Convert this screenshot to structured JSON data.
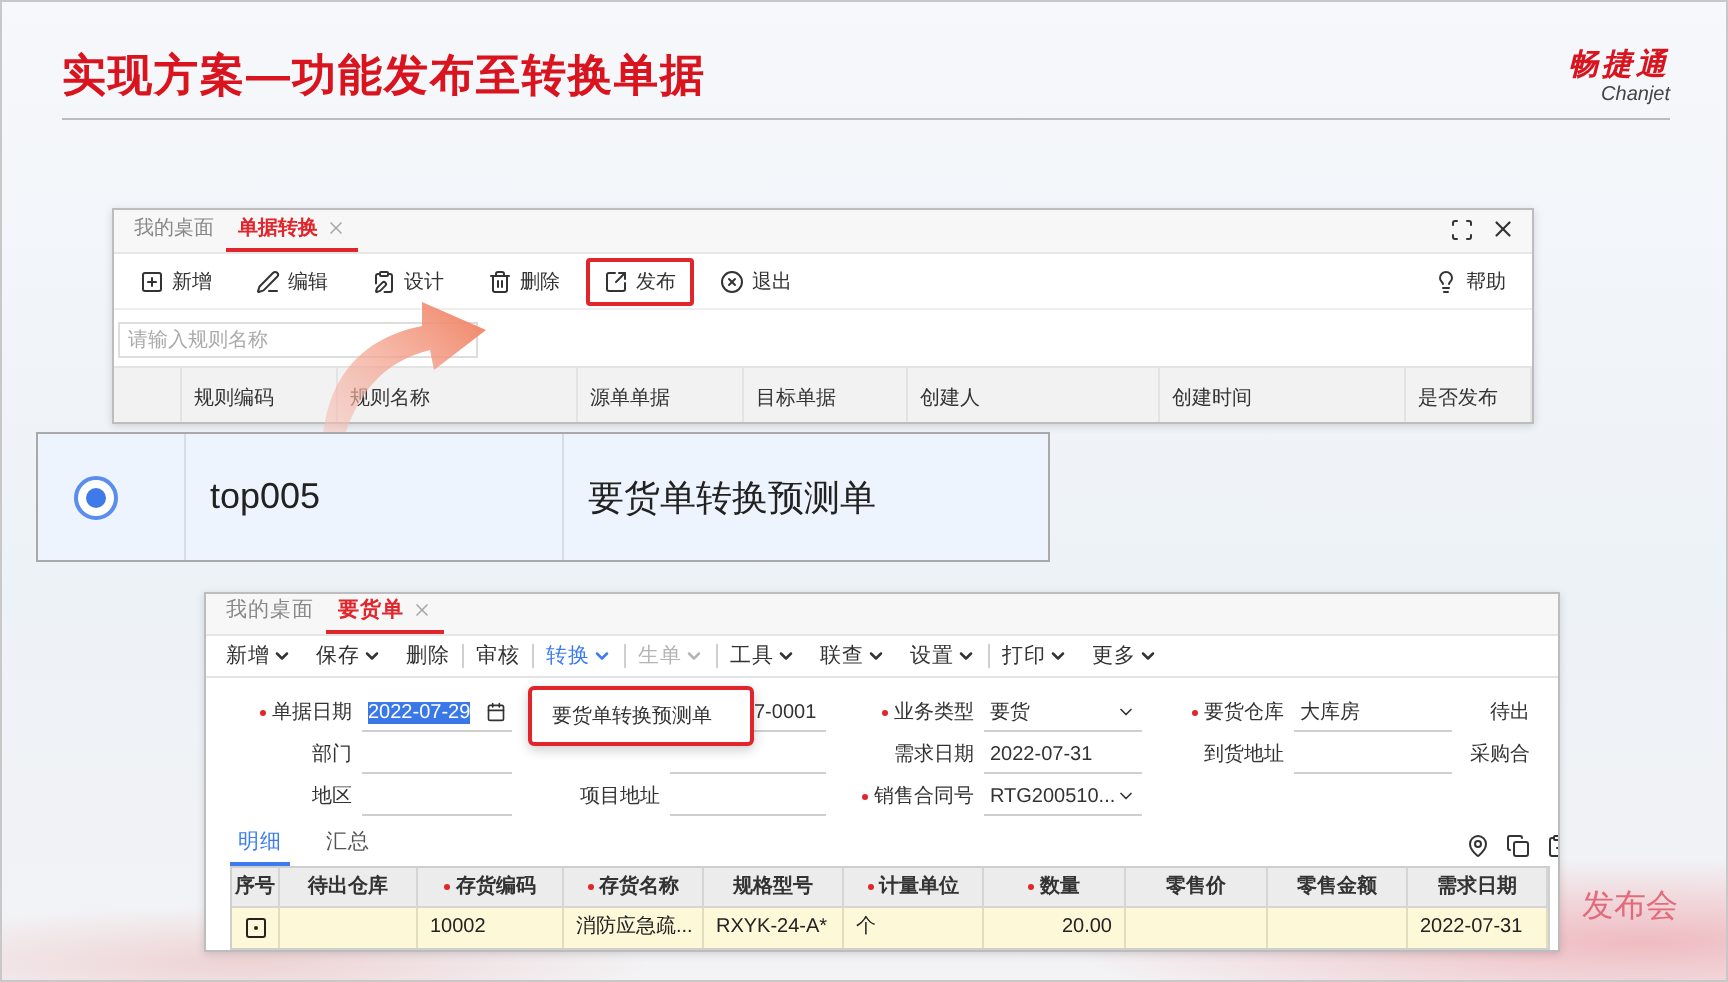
{
  "title": "实现方案—功能发布至转换单据",
  "logo": {
    "name": "畅捷通",
    "latin": "Chanjet"
  },
  "rule_window": {
    "tabs": [
      {
        "label": "我的桌面",
        "selected": false,
        "closable": false
      },
      {
        "label": "单据转换",
        "selected": true,
        "closable": true
      }
    ],
    "toolbar": [
      {
        "label": "新增",
        "highlighted": false
      },
      {
        "label": "编辑",
        "highlighted": false
      },
      {
        "label": "设计",
        "highlighted": false
      },
      {
        "label": "删除",
        "highlighted": false
      },
      {
        "label": "发布",
        "highlighted": true
      },
      {
        "label": "退出",
        "highlighted": false
      }
    ],
    "help": "帮助",
    "search": {
      "placeholder": "请输入规则名称"
    },
    "columns": [
      "规则编码",
      "规则名称",
      "源单单据",
      "目标单据",
      "创建人",
      "创建时间",
      "是否发布"
    ]
  },
  "zoomed_row": {
    "selected": true,
    "code": "top005",
    "name": "要货单转换预测单"
  },
  "order_window": {
    "tabs": [
      {
        "label": "我的桌面",
        "selected": false,
        "closable": false
      },
      {
        "label": "要货单",
        "selected": true,
        "closable": true
      }
    ],
    "toolbar": [
      {
        "label": "新增",
        "dropdown": true,
        "active": false,
        "disabled": false,
        "separator_after": false
      },
      {
        "label": "保存",
        "dropdown": true,
        "active": false,
        "disabled": false,
        "separator_after": false
      },
      {
        "label": "删除",
        "dropdown": false,
        "active": false,
        "disabled": false,
        "separator_after": true
      },
      {
        "label": "审核",
        "dropdown": false,
        "active": false,
        "disabled": false,
        "separator_after": true
      },
      {
        "label": "转换",
        "dropdown": true,
        "active": true,
        "disabled": false,
        "separator_after": true
      },
      {
        "label": "生单",
        "dropdown": true,
        "active": false,
        "disabled": true,
        "separator_after": true
      },
      {
        "label": "工具",
        "dropdown": true,
        "active": false,
        "disabled": false,
        "separator_after": false
      },
      {
        "label": "联查",
        "dropdown": true,
        "active": false,
        "disabled": false,
        "separator_after": false
      },
      {
        "label": "设置",
        "dropdown": true,
        "active": false,
        "disabled": false,
        "separator_after": true
      },
      {
        "label": "打印",
        "dropdown": true,
        "active": false,
        "disabled": false,
        "separator_after": false
      },
      {
        "label": "更多",
        "dropdown": true,
        "active": false,
        "disabled": false,
        "separator_after": false
      }
    ],
    "form": [
      [
        {
          "label": "单据日期",
          "required": true,
          "kind": "date",
          "value": "2022-07-29",
          "selected": true
        },
        {
          "kind": "text",
          "value": "7-0001"
        },
        {
          "label": "业务类型",
          "required": true,
          "kind": "select",
          "value": "要货"
        },
        {
          "label": "要货仓库",
          "required": true,
          "kind": "text",
          "value": "大库房"
        },
        {
          "label": "待出",
          "required": false,
          "kind": "label"
        }
      ],
      [
        {
          "label": "部门",
          "required": false,
          "kind": "text"
        },
        {
          "kind": "text"
        },
        {
          "label": "需求日期",
          "required": false,
          "kind": "text",
          "value": "2022-07-31"
        },
        {
          "label": "到货地址",
          "required": false,
          "kind": "text"
        },
        {
          "label": "采购合",
          "required": false,
          "kind": "label"
        }
      ],
      [
        {
          "label": "地区",
          "required": false,
          "kind": "text"
        },
        {
          "label": "项目地址",
          "required": false,
          "kind": "text"
        },
        {
          "label": "销售合同号",
          "required": true,
          "kind": "select",
          "value": "RTG200510..."
        }
      ]
    ],
    "popup": {
      "items": [
        {
          "label": "要货单转换预测单",
          "highlighted": true
        }
      ]
    },
    "subtabs": [
      {
        "label": "明细",
        "selected": true
      },
      {
        "label": "汇总",
        "selected": false
      }
    ],
    "columns": [
      {
        "label": "序号",
        "required": false
      },
      {
        "label": "待出仓库",
        "required": false
      },
      {
        "label": "存货编码",
        "required": true
      },
      {
        "label": "存货名称",
        "required": true
      },
      {
        "label": "规格型号",
        "required": false
      },
      {
        "label": "计量单位",
        "required": true
      },
      {
        "label": "数量",
        "required": true
      },
      {
        "label": "零售价",
        "required": false
      },
      {
        "label": "零售金额",
        "required": false
      },
      {
        "label": "需求日期",
        "required": false
      }
    ],
    "rows": [
      {
        "cells": [
          "",
          "",
          "10002",
          "消防应急疏...",
          "RXYK-24-A*",
          "个",
          "20.00",
          "",
          "",
          "2022-07-31"
        ]
      }
    ]
  },
  "footer_text": "发布会"
}
